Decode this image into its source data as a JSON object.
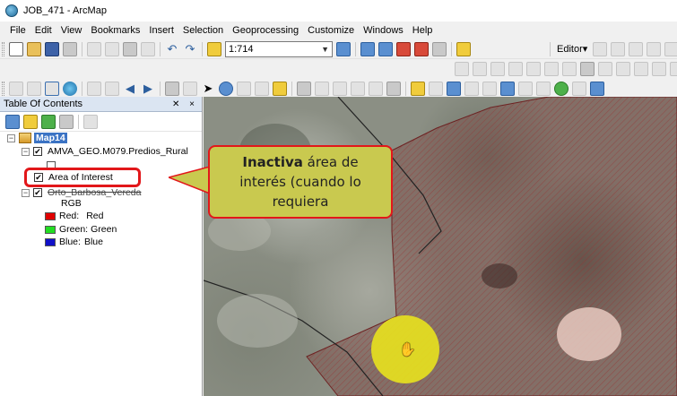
{
  "window": {
    "title": "JOB_471 - ArcMap"
  },
  "menu": [
    "File",
    "Edit",
    "View",
    "Bookmarks",
    "Insert",
    "Selection",
    "Geoprocessing",
    "Customize",
    "Windows",
    "Help"
  ],
  "toolbar": {
    "scale_value": "1:714",
    "editor_label": "Editor▾"
  },
  "toc": {
    "title": "Table Of Contents",
    "controls": "✕ ×",
    "map_name": "Map14",
    "layer1": "AMVA_GEO.M079.Predios_Rural",
    "layer2": "Area of Interest",
    "layer3": "Orto_Barbosa_Vereda",
    "rgb_label": "RGB",
    "bands": [
      {
        "label": "Red:",
        "value": "Red",
        "color": "#e00000"
      },
      {
        "label": "Green:",
        "value": "Green",
        "color": "#22dd22"
      },
      {
        "label": "Blue:",
        "value": "Blue",
        "color": "#1010c8"
      }
    ]
  },
  "callout": {
    "bold_word": "Inactiva",
    "line1_rest": " área de",
    "line2": "interés (cuando lo",
    "line3": "requiera"
  },
  "colors": {
    "callout_fill": "#c9c94f",
    "highlight_red": "#e2171a",
    "cursor_halo": "#e6df20",
    "map_selection": "#8c3a3a"
  }
}
